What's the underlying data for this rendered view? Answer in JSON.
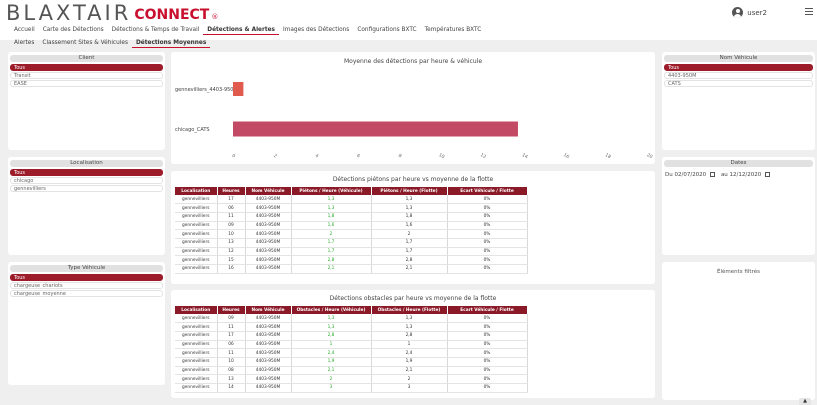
{
  "header": {
    "logo_main": "BLAXTAIR",
    "logo_connect": "CONNECT",
    "logo_reg": "®",
    "user_name": "user2"
  },
  "nav": {
    "row1": [
      {
        "label": "Accueil",
        "active": false
      },
      {
        "label": "Carte des Détections",
        "active": false
      },
      {
        "label": "Détections & Temps de Travail",
        "active": false
      },
      {
        "label": "Détections & Alertes",
        "active": true
      },
      {
        "label": "Images des Détections",
        "active": false
      },
      {
        "label": "Configurations BXTC",
        "active": false
      },
      {
        "label": "Températures BXTC",
        "active": false
      }
    ],
    "row2": [
      {
        "label": "Alertes",
        "active": false
      },
      {
        "label": "Classement Sites & Véhicules",
        "active": false
      },
      {
        "label": "Détections Moyennes",
        "active": true
      }
    ]
  },
  "filters": {
    "client": {
      "title": "Client",
      "options": [
        {
          "label": "Tous",
          "selected": true
        },
        {
          "label": "Transit",
          "selected": false
        },
        {
          "label": "EASE",
          "selected": false
        }
      ]
    },
    "localisation": {
      "title": "Localisation",
      "options": [
        {
          "label": "Tous",
          "selected": true
        },
        {
          "label": "chicago",
          "selected": false
        },
        {
          "label": "gennevilliers",
          "selected": false
        }
      ]
    },
    "type_vehicule": {
      "title": "Type Véhicule",
      "options": [
        {
          "label": "Tous",
          "selected": true
        },
        {
          "label": "chargeuse_chariots",
          "selected": false
        },
        {
          "label": "chargeuse_moyenne",
          "selected": false
        }
      ]
    },
    "nom_vehicule": {
      "title": "Nom Véhicule",
      "options": [
        {
          "label": "Tous",
          "selected": true
        },
        {
          "label": "4403-950M",
          "selected": false
        },
        {
          "label": "CATS",
          "selected": false
        }
      ]
    },
    "dates": {
      "title": "Dates",
      "from_label": "Du",
      "from_value": "02/07/2020",
      "to_label": "au",
      "to_value": "12/12/2020"
    },
    "selected_elements": {
      "title": "Éléments filtrés"
    }
  },
  "colors": {
    "accent": "#8b1a28",
    "selected": "#9c1c2a",
    "bar1": "#e05a4e",
    "bar2": "#c24a64",
    "green": "#2aa82a"
  },
  "chart_data": {
    "type": "bar",
    "orientation": "horizontal",
    "title": "Moyenne des détections par heure & véhicule",
    "categories": [
      "gennevilliers_4403-950M",
      "chicago_CATS"
    ],
    "values": [
      0.5,
      13.7
    ],
    "xlim": [
      0,
      20
    ],
    "xticks": [
      0,
      2,
      4,
      6,
      8,
      10,
      12,
      14,
      16,
      18,
      20
    ],
    "grid": false,
    "legend": "none"
  },
  "pietons": {
    "title": "Détections piétons par heure vs moyenne de la flotte",
    "columns": [
      "Localisation",
      "Heures",
      "Nom Véhicule",
      "Piétons / Heure (Véhicule)",
      "Piétons / Heure (Flotte)",
      "Ecart Véhicule / Flotte"
    ],
    "rows": [
      [
        "gennevilliers",
        "17",
        "4403-950M",
        "1,3",
        "1,3",
        "0%"
      ],
      [
        "gennevilliers",
        "06",
        "4403-950M",
        "1,3",
        "1,3",
        "0%"
      ],
      [
        "gennevilliers",
        "11",
        "4403-950M",
        "1,8",
        "1,8",
        "0%"
      ],
      [
        "gennevilliers",
        "09",
        "4403-950M",
        "1,6",
        "1,6",
        "0%"
      ],
      [
        "gennevilliers",
        "10",
        "4403-950M",
        "2",
        "2",
        "0%"
      ],
      [
        "gennevilliers",
        "13",
        "4403-950M",
        "1,7",
        "1,7",
        "0%"
      ],
      [
        "gennevilliers",
        "12",
        "4403-950M",
        "1,7",
        "1,7",
        "0%"
      ],
      [
        "gennevilliers",
        "15",
        "4403-950M",
        "2,8",
        "2,8",
        "0%"
      ],
      [
        "gennevilliers",
        "16",
        "4403-950M",
        "2,1",
        "2,1",
        "0%"
      ]
    ]
  },
  "obstacles": {
    "title": "Détections obstacles par heure vs moyenne de la flotte",
    "columns": [
      "Localisation",
      "Heures",
      "Nom Véhicule",
      "Obstacles / Heure (Véhicule)",
      "Obstacles / Heure (Flotte)",
      "Ecart Véhicule / Flotte"
    ],
    "rows": [
      [
        "gennevilliers",
        "09",
        "4403-950M",
        "1,3",
        "1,3",
        "0%"
      ],
      [
        "gennevilliers",
        "11",
        "4403-950M",
        "1,3",
        "1,3",
        "0%"
      ],
      [
        "gennevilliers",
        "17",
        "4403-950M",
        "2,8",
        "2,8",
        "0%"
      ],
      [
        "gennevilliers",
        "06",
        "4403-950M",
        "1",
        "1",
        "0%"
      ],
      [
        "gennevilliers",
        "11",
        "4403-950M",
        "2,4",
        "2,4",
        "0%"
      ],
      [
        "gennevilliers",
        "10",
        "4403-950M",
        "1,9",
        "1,9",
        "0%"
      ],
      [
        "gennevilliers",
        "08",
        "4403-950M",
        "2,1",
        "2,1",
        "0%"
      ],
      [
        "gennevilliers",
        "13",
        "4403-950M",
        "2",
        "2",
        "0%"
      ],
      [
        "gennevilliers",
        "14",
        "4403-950M",
        "3",
        "3",
        "0%"
      ]
    ]
  }
}
